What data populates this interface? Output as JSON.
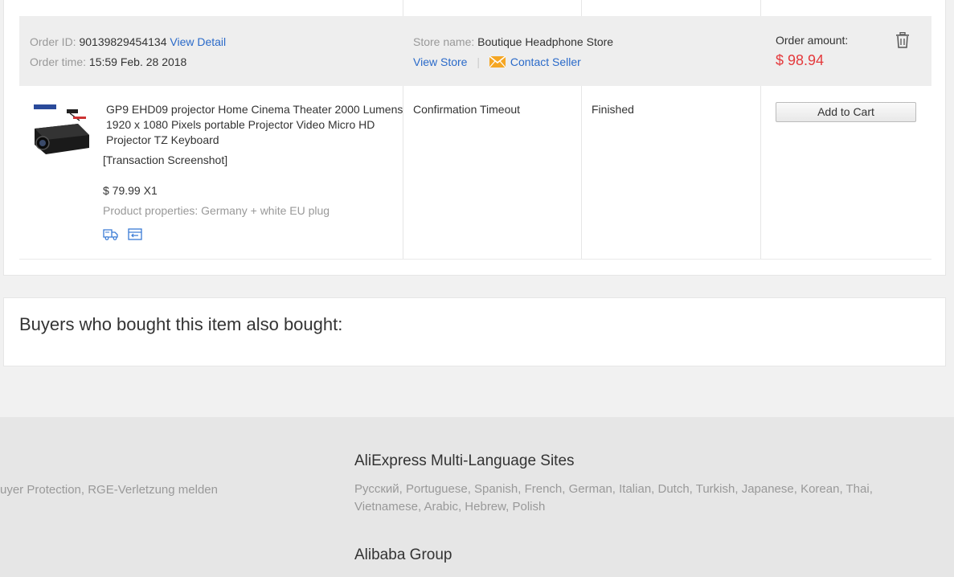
{
  "order": {
    "id_label": "Order ID:",
    "id_value": "90139829454134",
    "view_detail": "View Detail",
    "time_label": "Order time:",
    "time_value": "15:59 Feb. 28 2018",
    "store_label": "Store name:",
    "store_value": "Boutique Headphone Store",
    "view_store": "View Store",
    "separator": "|",
    "contact_seller": "Contact Seller",
    "amount_label": "Order amount:",
    "amount_value": "$ 98.94"
  },
  "item": {
    "title": "GP9 EHD09 projector Home Cinema Theater 2000 Lumens 1920 x 1080 Pixels portable Projector Video Micro HD Projector TZ Keyboard",
    "snapshot": "[Transaction Screenshot]",
    "price_qty": "$ 79.99 X1",
    "properties": "Product properties: Germany + white EU plug",
    "status": "Confirmation Timeout",
    "order_status": "Finished",
    "add_to_cart": "Add to Cart",
    "icons": [
      "shipping-truck-icon",
      "return-icon"
    ]
  },
  "also_bought": {
    "title": "Buyers who bought this item also bought:"
  },
  "footer": {
    "left_text": "uyer Protection, RGE-Verletzung melden",
    "multi_lang_title": "AliExpress Multi-Language Sites",
    "languages_line1": "Русский, Portuguese, Spanish, French, German, Italian, Dutch, Turkish, Japanese, Korean, Thai,",
    "languages_line2": "Vietnamese, Arabic, Hebrew, Polish",
    "group_title": "Alibaba Group"
  },
  "colors": {
    "link": "#2a6ac9",
    "price": "#e4393c",
    "mail_icon": "#f5a623",
    "header_bg": "#eeeeee",
    "footer_bg": "#e6e6e6"
  }
}
